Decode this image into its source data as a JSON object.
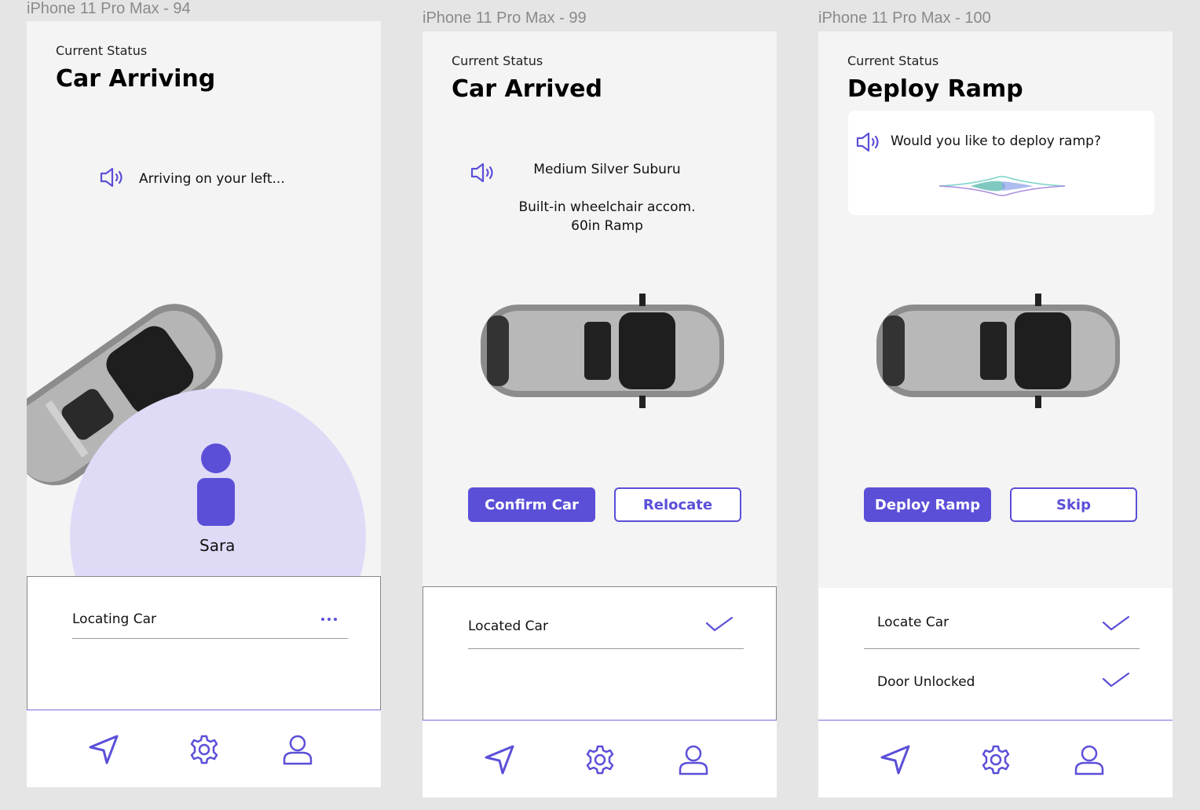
{
  "frames": [
    {
      "label": "iPhone 11 Pro Max - 94",
      "status_label": "Current Status",
      "status_title": "Car Arriving",
      "message": "Arriving on your left...",
      "user_name": "Sara",
      "rows": [
        {
          "text": "Locating Car",
          "state": "in-progress"
        }
      ]
    },
    {
      "label": "iPhone 11 Pro Max - 99",
      "status_label": "Current Status",
      "status_title": "Car Arrived",
      "car_name": "Medium Silver Suburu",
      "car_features_line1": "Built-in wheelchair accom.",
      "car_features_line2": "60in Ramp",
      "primary_button": "Confirm Car",
      "secondary_button": "Relocate",
      "rows": [
        {
          "text": "Located Car",
          "state": "done"
        }
      ]
    },
    {
      "label": "iPhone 11 Pro Max - 100",
      "status_label": "Current Status",
      "status_title": "Deploy Ramp",
      "prompt": "Would you like to deploy ramp?",
      "primary_button": "Deploy Ramp",
      "secondary_button": "Skip",
      "rows": [
        {
          "text": "Locate Car",
          "state": "done"
        },
        {
          "text": "Door Unlocked",
          "state": "done"
        }
      ]
    }
  ],
  "tabs": [
    {
      "icon": "navigation-arrow-icon"
    },
    {
      "icon": "gear-icon"
    },
    {
      "icon": "user-icon"
    }
  ],
  "colors": {
    "accent": "#5b4fd8",
    "accent_light": "#dfdbf7",
    "background": "#f4f4f4"
  }
}
